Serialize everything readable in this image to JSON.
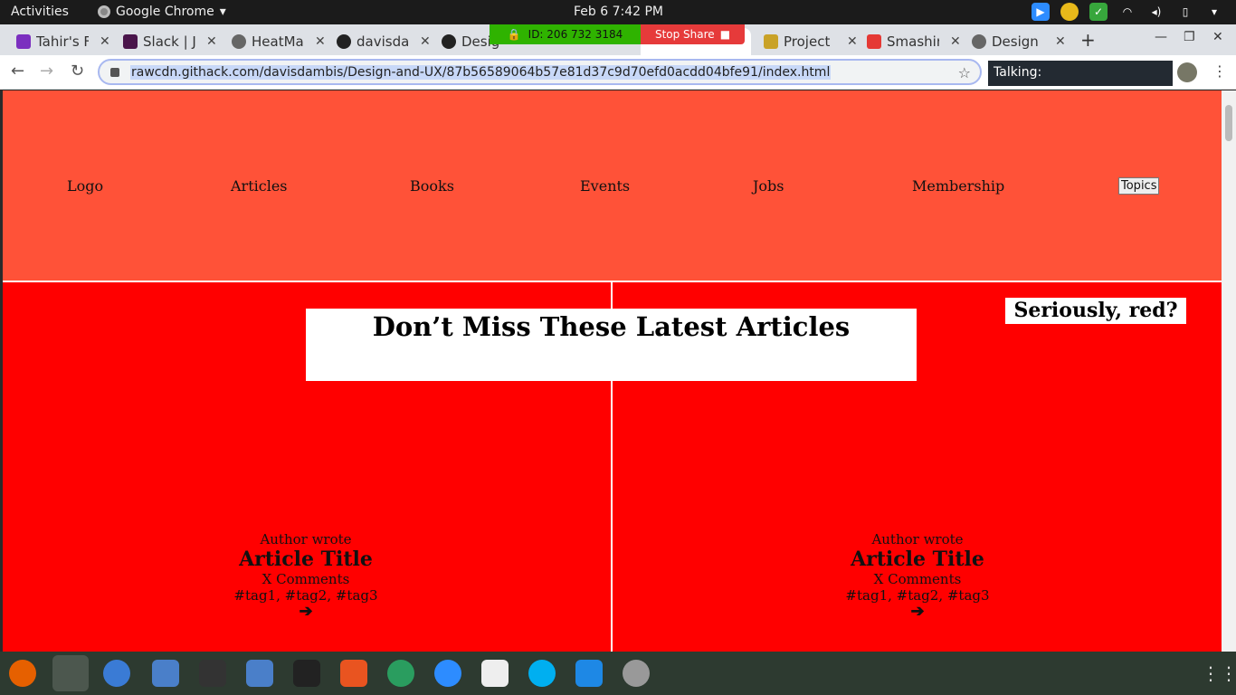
{
  "system": {
    "activities": "Activities",
    "app_name": "Google Chrome",
    "clock": "Feb 6   7:42 PM"
  },
  "tabs": [
    {
      "title": "Tahir's F",
      "color": "#7b2fbf"
    },
    {
      "title": "Slack | J",
      "color": "#4a154b"
    },
    {
      "title": "HeatMa",
      "color": "#666666"
    },
    {
      "title": "davisda",
      "color": "#222222"
    },
    {
      "title": "Desig",
      "color": "#222222"
    },
    {
      "title": "Project",
      "color": "#c9a227"
    },
    {
      "title": "Smashin",
      "color": "#e53935"
    },
    {
      "title": "Design",
      "color": "#666666"
    }
  ],
  "zoom": {
    "meeting_id": "ID: 206 732 3184",
    "stop_share": "Stop Share"
  },
  "toolbar": {
    "url": "rawcdn.githack.com/davisdambis/Design-and-UX/87b56589064b57e81d37c9d70efd0acdd04bfe91/index.html",
    "talking": "Talking:"
  },
  "site": {
    "nav": [
      "Logo",
      "Articles",
      "Books",
      "Events",
      "Jobs",
      "Membership"
    ],
    "topics": "Topics",
    "headline": "Don’t Miss These Latest Articles",
    "aside": "Seriously, red?",
    "cards": [
      {
        "author": "Author wrote",
        "title": "Article Title",
        "comments": "X Comments",
        "tags": "#tag1, #tag2, #tag3",
        "arrow": "➔"
      },
      {
        "author": "Author wrote",
        "title": "Article Title",
        "comments": "X Comments",
        "tags": "#tag1, #tag2, #tag3",
        "arrow": "➔"
      }
    ]
  },
  "colors": {
    "nav_bg": "#ff5238",
    "main_bg": "#ff0000",
    "zoom_green": "#2fb300",
    "zoom_red": "#e63a3a"
  }
}
